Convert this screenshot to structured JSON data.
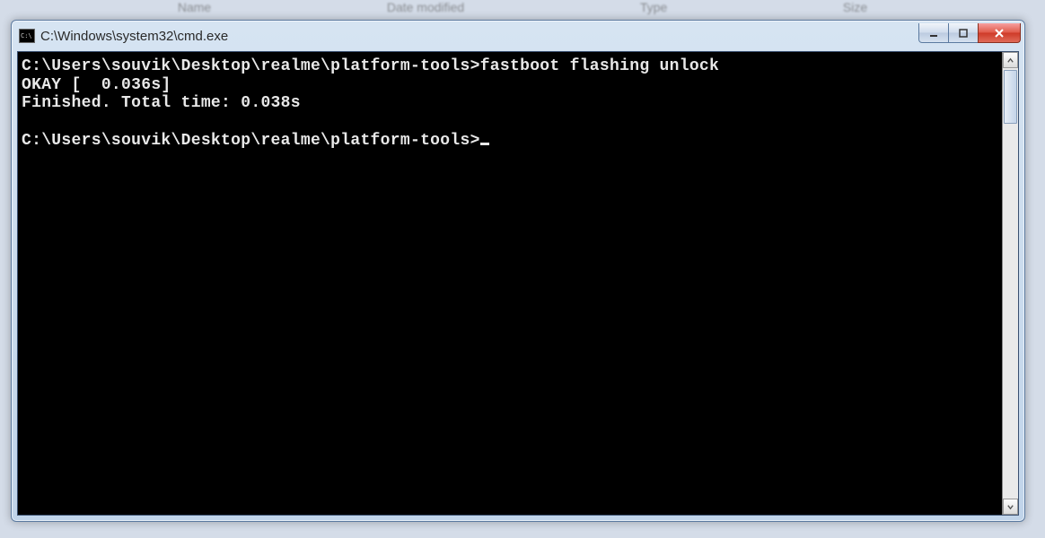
{
  "background_hints": {
    "col1": "Name",
    "col2": "Date modified",
    "col3": "Type",
    "col4": "Size"
  },
  "window": {
    "icon_alt": "cmd-icon",
    "title": "C:\\Windows\\system32\\cmd.exe"
  },
  "controls": {
    "minimize": "minimize",
    "maximize": "maximize",
    "close": "close"
  },
  "terminal": {
    "line1_prompt": "C:\\Users\\souvik\\Desktop\\realme\\platform-tools>",
    "line1_cmd": "fastboot flashing unlock",
    "line2": "OKAY [  0.036s]",
    "line3": "Finished. Total time: 0.038s",
    "blank": "",
    "line4_prompt": "C:\\Users\\souvik\\Desktop\\realme\\platform-tools>"
  }
}
